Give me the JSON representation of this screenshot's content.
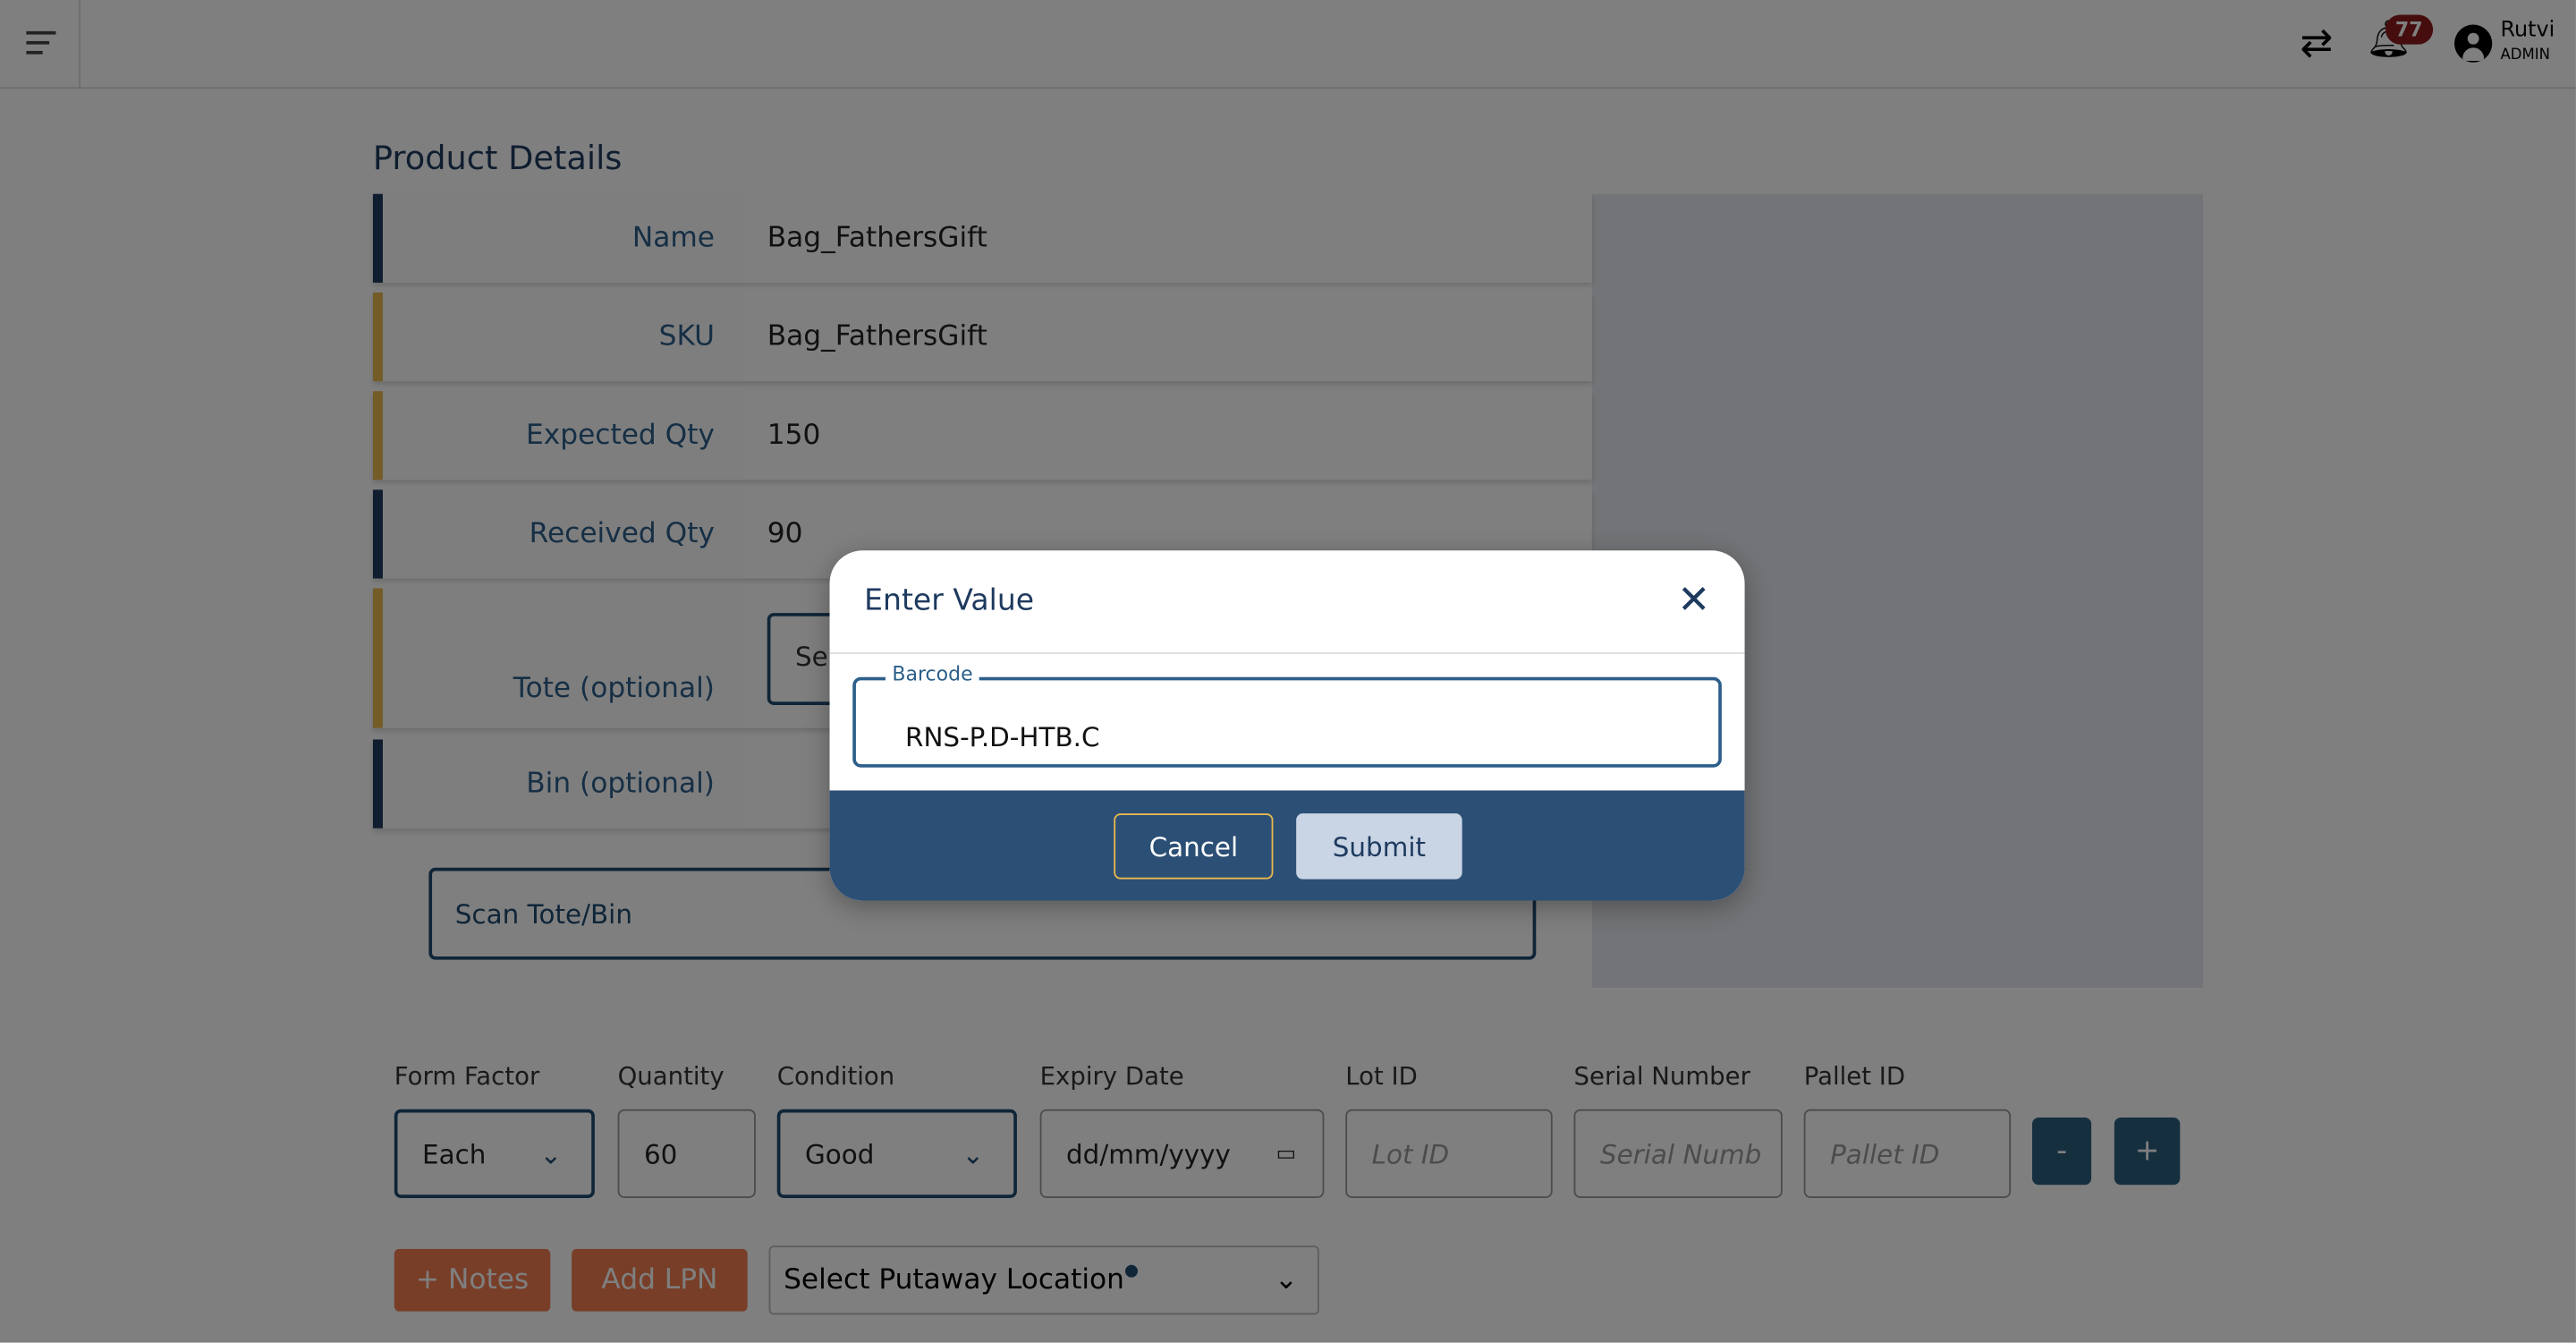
{
  "header": {
    "menu_icon": "hamburger-icon",
    "transfer_icon": "swap-arrows-icon",
    "notifications_count": "77",
    "user_name": "Rutvi",
    "user_role": "ADMIN"
  },
  "product": {
    "title": "Product Details",
    "rows": [
      {
        "label": "Name",
        "value": "Bag_FathersGift"
      },
      {
        "label": "SKU",
        "value": "Bag_FathersGift"
      },
      {
        "label": "Expected Qty",
        "value": "150"
      },
      {
        "label": "Received Qty",
        "value": "90"
      },
      {
        "label": "Tote (optional)",
        "value": "Sea"
      },
      {
        "label": "Bin (optional)",
        "value": ""
      }
    ],
    "scan_placeholder": "Scan Tote/Bin"
  },
  "form": {
    "form_factor_label": "Form Factor",
    "form_factor": "Each",
    "quantity_label": "Quantity",
    "quantity": "60",
    "condition_label": "Condition",
    "condition": "Good",
    "expiry_label": "Expiry Date",
    "expiry_placeholder": "dd/mm/yyyy",
    "lot_label": "Lot ID",
    "lot_placeholder": "Lot ID",
    "serial_label": "Serial Number",
    "serial_placeholder": "Serial Numb",
    "pallet_label": "Pallet ID",
    "pallet_placeholder": "Pallet ID",
    "minus": "-",
    "plus": "+",
    "notes": "+ Notes",
    "add_lpn": "Add LPN",
    "putaway": "Select Putaway Location"
  },
  "modal": {
    "title": "Enter Value",
    "field_label": "Barcode",
    "field_value": "RNS-P.D-HTB.C",
    "cancel": "Cancel",
    "submit": "Submit"
  },
  "colors": {
    "navy": "#1e3a5f",
    "footer": "#2c4f75",
    "accent_orange": "#f07c50",
    "gold": "#e8b84f",
    "badge": "#8b1a1a"
  }
}
